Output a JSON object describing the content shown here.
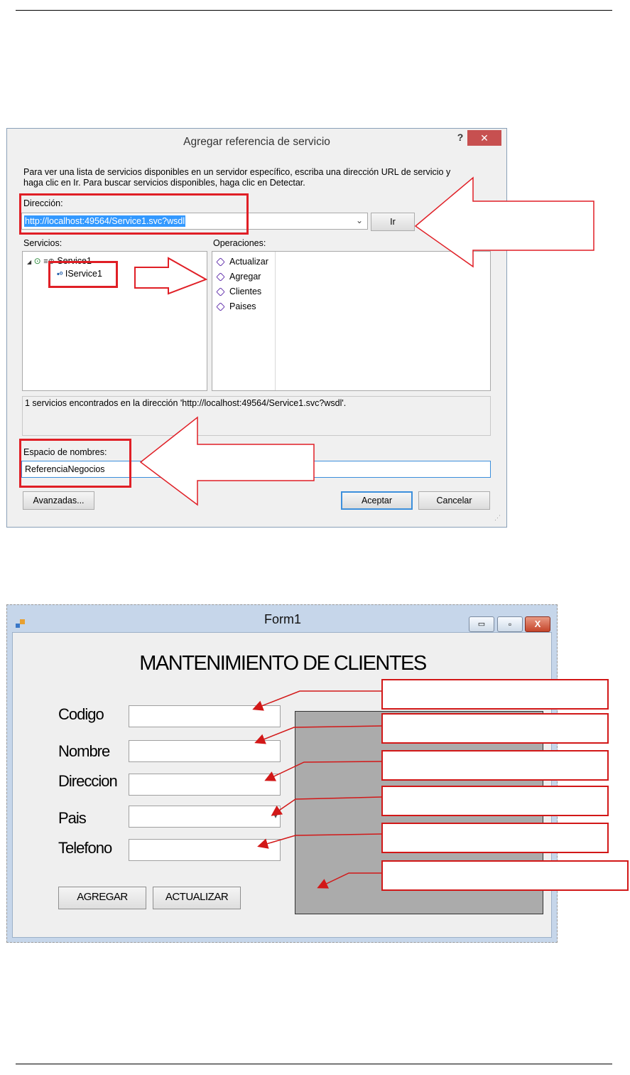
{
  "dialog": {
    "title": "Agregar referencia de servicio",
    "help_label": "?",
    "close_label": "✕",
    "instructions_line1": "Para ver una lista de servicios disponibles en un servidor específico, escriba una dirección URL de servicio y",
    "instructions_line2": "haga clic en Ir. Para buscar servicios disponibles, haga clic en Detectar.",
    "address_label": "Dirección:",
    "address_value": "http://localhost:49564/Service1.svc?wsdl",
    "go_button": "Ir",
    "services_label": "Servicios:",
    "services_tree": {
      "root": "Service1",
      "child": "IService1"
    },
    "operations_label": "Operaciones:",
    "operations": [
      "Actualizar",
      "Agregar",
      "Clientes",
      "Paises"
    ],
    "status_text": "1 servicios encontrados en la dirección 'http://localhost:49564/Service1.svc?wsdl'.",
    "namespace_label": "Espacio de nombres:",
    "namespace_value": "ReferenciaNegocios",
    "advanced_button": "Avanzadas...",
    "ok_button": "Aceptar",
    "cancel_button": "Cancelar"
  },
  "form": {
    "window_title": "Form1",
    "heading": "MANTENIMIENTO DE CLIENTES",
    "labels": {
      "codigo": "Codigo",
      "nombre": "Nombre",
      "direccion": "Direccion",
      "pais": "Pais",
      "telefono": "Telefono"
    },
    "buttons": {
      "agregar": "AGREGAR",
      "actualizar": "ACTUALIZAR"
    },
    "fields": {
      "codigo": "",
      "nombre": "",
      "direccion": "",
      "pais": "",
      "telefono": ""
    },
    "window_controls": {
      "minimize": "▭",
      "maximize": "▫",
      "close": "X"
    }
  },
  "colors": {
    "annotation_red": "#e01f26",
    "selection_blue": "#3399ff",
    "grid_gray": "#a9a9a9"
  }
}
